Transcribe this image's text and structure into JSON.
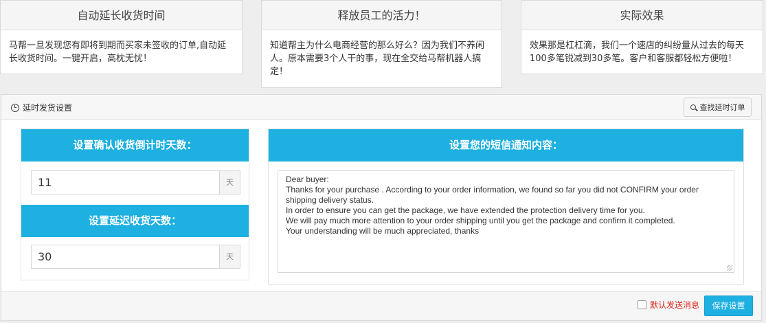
{
  "cards": [
    {
      "title": "自动延长收货时间",
      "body": "马帮一旦发现您有即将到期而买家未签收的订单,自动延长收货时间。一键开启，高枕无忧！"
    },
    {
      "title": "释放员工的活力！",
      "body": "知道帮主为什么电商经营的那么好么？因为我们不养闲人。原本需要3个人干的事，现在全交给马帮机器人搞定！"
    },
    {
      "title": "实际效果",
      "body": "效果那是杠杠滴，我们一个速店的纠纷量从过去的每天100多笔锐减到30多笔。客户和客服都轻松方便啦！"
    }
  ],
  "panel": {
    "title": "延时发货设置",
    "find_button": "查找延时订单",
    "confirm_days": {
      "label": "设置确认收货倒计时天数：",
      "value": "11",
      "unit": "天"
    },
    "extend_days": {
      "label": "设置延迟收货天数：",
      "value": "30",
      "unit": "天"
    },
    "sms": {
      "label": "设置您的短信通知内容：",
      "content": "Dear buyer:\nThanks for your purchase . According to your order information, we found so far you did not CONFIRM your order shipping delivery status.\nIn order to ensure you can get the package, we have extended the protection delivery time for you.\nWe will pay much more attention to your order shipping until you get the package and confirm it completed.\nYour understanding will be much appreciated, thanks"
    },
    "default_send_label": "默认发送消息",
    "save_button": "保存设置"
  },
  "colors": {
    "accent": "#1db0e1",
    "warning_text": "#d8281b"
  },
  "icons": {
    "panel_title": "clock-icon",
    "find_button": "search-icon",
    "textarea_corner": "resize-grip-icon"
  }
}
